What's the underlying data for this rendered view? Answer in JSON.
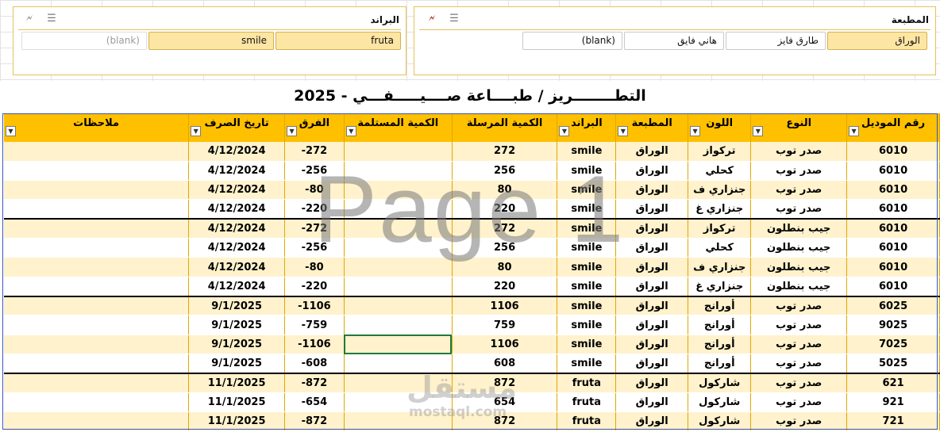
{
  "slicers": {
    "press": {
      "title": "المطبعة",
      "items": [
        {
          "label": "الوراق",
          "state": "selected"
        },
        {
          "label": "طارق فايز",
          "state": "unselected"
        },
        {
          "label": "هاني فايق",
          "state": "unselected"
        },
        {
          "label": "(blank)",
          "state": "unselected"
        }
      ]
    },
    "brand": {
      "title": "البراند",
      "items": [
        {
          "label": "fruta",
          "state": "selected"
        },
        {
          "label": "smile",
          "state": "selected"
        },
        {
          "label": "(blank)",
          "state": "dim"
        }
      ]
    }
  },
  "sheet": {
    "title": "التطــــــــريز / طبــــاعة صــــيـــــفـــي - 2025",
    "headers": {
      "model": "رقم الموديل",
      "type": "النوع",
      "color": "اللون",
      "press": "المطبعة",
      "brand": "البراند",
      "sent": "الكمية المرسلة",
      "received": "الكمية المستلمة",
      "diff": "الفرق",
      "date": "تاريخ الصرف",
      "notes": "ملاحظات"
    },
    "rows": [
      {
        "model": "6010",
        "type": "صدر توب",
        "color": "تركواز",
        "press": "الوراق",
        "brand": "smile",
        "sent": "272",
        "received": "",
        "diff": "-272",
        "date": "4/12/2024",
        "notes": ""
      },
      {
        "model": "6010",
        "type": "صدر توب",
        "color": "كحلي",
        "press": "الوراق",
        "brand": "smile",
        "sent": "256",
        "received": "",
        "diff": "-256",
        "date": "4/12/2024",
        "notes": ""
      },
      {
        "model": "6010",
        "type": "صدر توب",
        "color": "جنزاري ف",
        "press": "الوراق",
        "brand": "smile",
        "sent": "80",
        "received": "",
        "diff": "-80",
        "date": "4/12/2024",
        "notes": ""
      },
      {
        "model": "6010",
        "type": "صدر توب",
        "color": "جنزاري غ",
        "press": "الوراق",
        "brand": "smile",
        "sent": "220",
        "received": "",
        "diff": "-220",
        "date": "4/12/2024",
        "notes": ""
      },
      {
        "model": "6010",
        "type": "جيب بنطلون",
        "color": "تركواز",
        "press": "الوراق",
        "brand": "smile",
        "sent": "272",
        "received": "",
        "diff": "-272",
        "date": "4/12/2024",
        "notes": ""
      },
      {
        "model": "6010",
        "type": "جيب بنطلون",
        "color": "كحلي",
        "press": "الوراق",
        "brand": "smile",
        "sent": "256",
        "received": "",
        "diff": "-256",
        "date": "4/12/2024",
        "notes": ""
      },
      {
        "model": "6010",
        "type": "جيب بنطلون",
        "color": "جنزاري ف",
        "press": "الوراق",
        "brand": "smile",
        "sent": "80",
        "received": "",
        "diff": "-80",
        "date": "4/12/2024",
        "notes": ""
      },
      {
        "model": "6010",
        "type": "جيب بنطلون",
        "color": "جنزاري غ",
        "press": "الوراق",
        "brand": "smile",
        "sent": "220",
        "received": "",
        "diff": "-220",
        "date": "4/12/2024",
        "notes": ""
      },
      {
        "model": "6025",
        "type": "صدر توب",
        "color": "أورانج",
        "press": "الوراق",
        "brand": "smile",
        "sent": "1106",
        "received": "",
        "diff": "-1106",
        "date": "9/1/2025",
        "notes": ""
      },
      {
        "model": "9025",
        "type": "صدر توب",
        "color": "أورانج",
        "press": "الوراق",
        "brand": "smile",
        "sent": "759",
        "received": "",
        "diff": "-759",
        "date": "9/1/2025",
        "notes": ""
      },
      {
        "model": "7025",
        "type": "صدر توب",
        "color": "أورانج",
        "press": "الوراق",
        "brand": "smile",
        "sent": "1106",
        "received": "",
        "diff": "-1106",
        "date": "9/1/2025",
        "notes": ""
      },
      {
        "model": "5025",
        "type": "صدر توب",
        "color": "أورانج",
        "press": "الوراق",
        "brand": "smile",
        "sent": "608",
        "received": "",
        "diff": "-608",
        "date": "9/1/2025",
        "notes": ""
      },
      {
        "model": "621",
        "type": "صدر توب",
        "color": "شاركول",
        "press": "الوراق",
        "brand": "fruta",
        "sent": "872",
        "received": "",
        "diff": "-872",
        "date": "11/1/2025",
        "notes": ""
      },
      {
        "model": "921",
        "type": "صدر توب",
        "color": "شاركول",
        "press": "الوراق",
        "brand": "fruta",
        "sent": "654",
        "received": "",
        "diff": "-654",
        "date": "11/1/2025",
        "notes": ""
      },
      {
        "model": "721",
        "type": "صدر توب",
        "color": "شاركول",
        "press": "الوراق",
        "brand": "fruta",
        "sent": "872",
        "received": "",
        "diff": "-872",
        "date": "11/1/2025",
        "notes": ""
      }
    ],
    "group_starts": [
      4,
      8,
      12
    ],
    "active_cell": {
      "row": 10,
      "col": "received"
    }
  },
  "watermark": {
    "text": "Page 1"
  },
  "logo": {
    "text": "مستقل",
    "sub": "mostaql.com"
  },
  "colors": {
    "header": "#ffc000",
    "band": "#fff2cc",
    "slicer_selected": "#fde5a4",
    "slicer_border": "#e6c257"
  }
}
